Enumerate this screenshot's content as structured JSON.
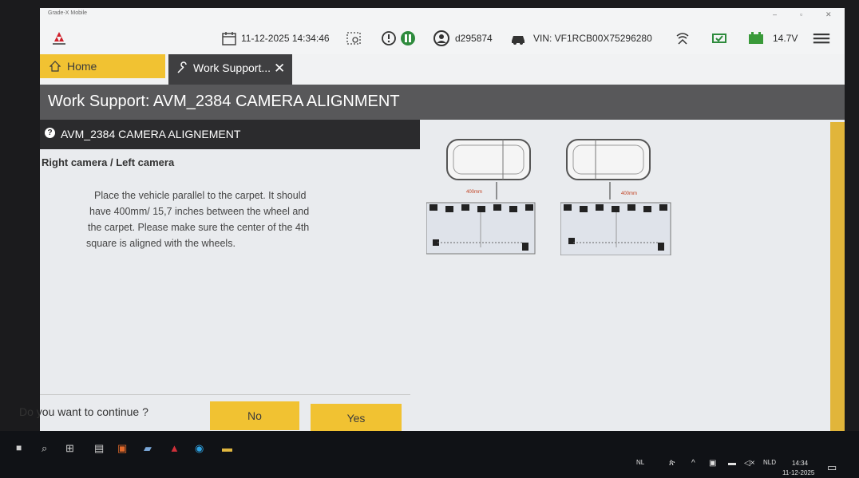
{
  "window": {
    "app_name": "Grade-X Mobile"
  },
  "toolbar": {
    "datetime": "11-12-2025 14:34:46",
    "user": "d295874",
    "vin": "VIN: VF1RCB00X75296280",
    "voltage": "14.7V"
  },
  "tabs": {
    "home": "Home",
    "work_support": "Work Support..."
  },
  "header": {
    "title": "Work Support: AVM_2384 CAMERA ALIGNMENT"
  },
  "subheader": {
    "title": "AVM_2384 CAMERA ALIGNEMENT"
  },
  "content": {
    "section_title": "Right camera / Left camera",
    "instructions": [
      "Place the vehicle parallel to the carpet. It should",
      "have 400mm/ 15,7 inches between the wheel and",
      "the carpet. Please make sure the center of the 4th",
      "square is aligned with the wheels."
    ],
    "diagram_label_left": "400mm",
    "diagram_label_right": "400mm"
  },
  "footer": {
    "question": "Do you want to continue ?",
    "no_label": "No",
    "yes_label": "Yes"
  },
  "taskbar": {
    "lang_short": "NL",
    "lang": "NLD",
    "time": "14:34",
    "date": "11-12-2025"
  },
  "colors": {
    "accent": "#f1c232",
    "header": "#58585a",
    "tab_active": "#3f3f41"
  }
}
